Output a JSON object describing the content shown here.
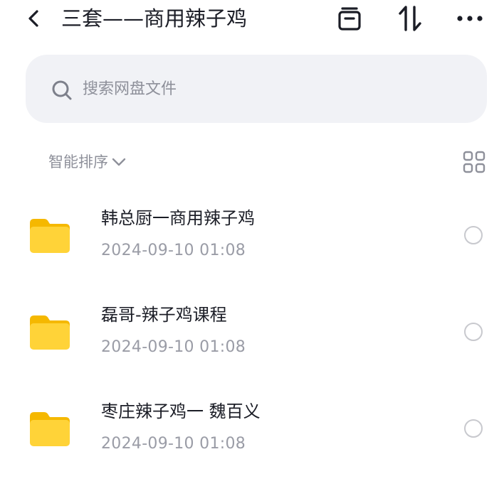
{
  "header": {
    "title": "三套——商用辣子鸡",
    "icons": [
      "back-arrow-icon",
      "archive-icon",
      "sort-icon",
      "more-icon"
    ]
  },
  "search": {
    "placeholder": "搜索网盘文件"
  },
  "sort": {
    "label": "智能排序"
  },
  "colors": {
    "folder": "#ffd338",
    "folder_tab": "#f5b800",
    "search_bg": "#f1f2f6",
    "secondary_text": "#9a9ca6"
  },
  "files": [
    {
      "name": "韩总厨一商用辣子鸡",
      "date": "2024-09-10  01:08"
    },
    {
      "name": "磊哥-辣子鸡课程",
      "date": "2024-09-10  01:08"
    },
    {
      "name": "枣庄辣子鸡一 魏百义",
      "date": "2024-09-10  01:08"
    }
  ]
}
